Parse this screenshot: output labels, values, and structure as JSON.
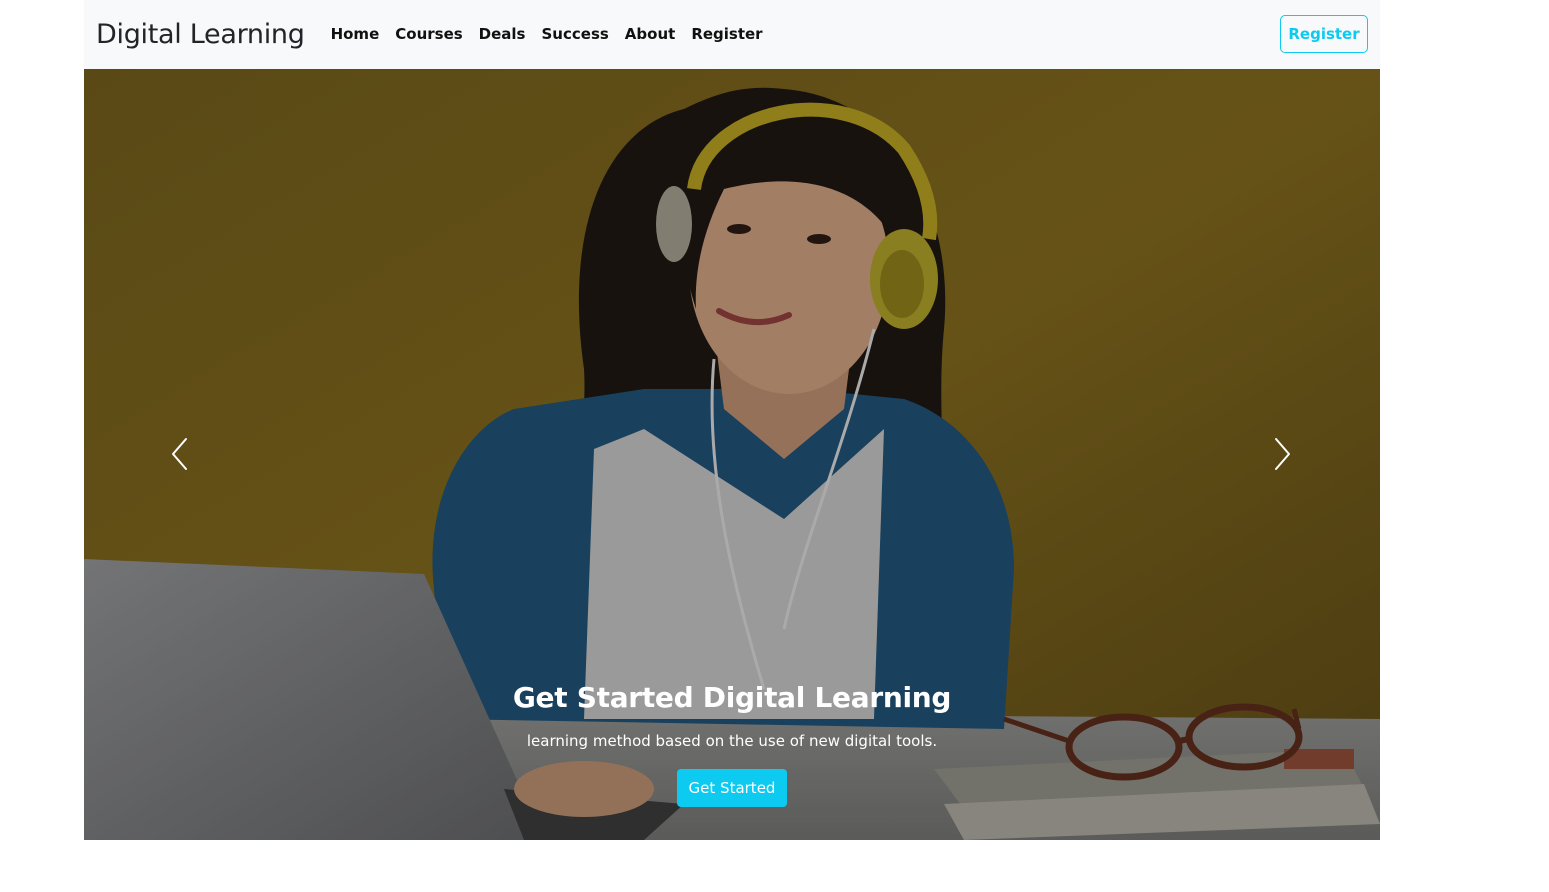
{
  "navbar": {
    "brand": "Digital Learning",
    "links": [
      "Home",
      "Courses",
      "Deals",
      "Success",
      "About",
      "Register"
    ],
    "register_button": "Register"
  },
  "hero": {
    "title": "Get Started Digital Learning",
    "subtitle": "learning method based on the use of new digital tools.",
    "cta_label": "Get Started",
    "prev_icon": "chevron-left-icon",
    "next_icon": "chevron-right-icon"
  },
  "colors": {
    "accent": "#0dcaf0",
    "navbar_bg": "#f8f9fa",
    "hero_bg": "#d4a51f"
  }
}
